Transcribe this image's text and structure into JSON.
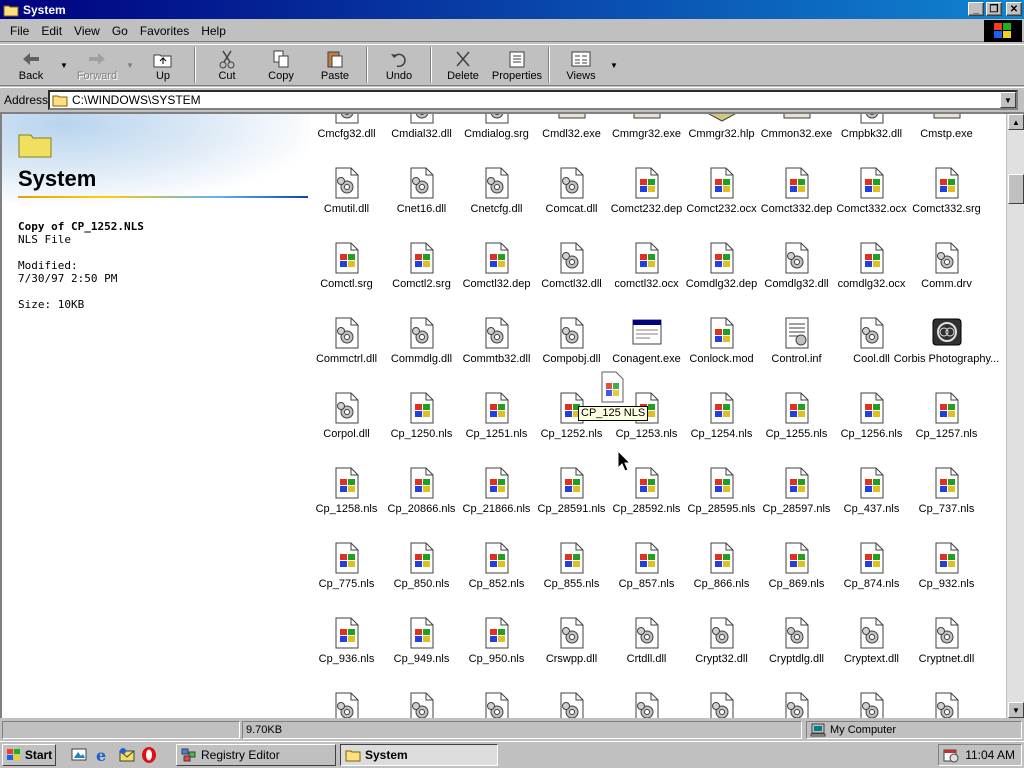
{
  "window": {
    "title": "System"
  },
  "menu": [
    "File",
    "Edit",
    "View",
    "Go",
    "Favorites",
    "Help"
  ],
  "toolbar": {
    "back": "Back",
    "forward": "Forward",
    "up": "Up",
    "cut": "Cut",
    "copy": "Copy",
    "paste": "Paste",
    "undo": "Undo",
    "delete": "Delete",
    "properties": "Properties",
    "views": "Views"
  },
  "address": {
    "label": "Address",
    "value": "C:\\WINDOWS\\SYSTEM"
  },
  "left_pane": {
    "title": "System",
    "selected_name": "Copy of CP_1252.NLS",
    "selected_type": "NLS File",
    "modified_label": "Modified:",
    "modified_value": "7/30/97 2:50 PM",
    "size": "Size: 10KB"
  },
  "files": [
    {
      "name": "Cmcfg32.dll",
      "icon": "dll"
    },
    {
      "name": "Cmdial32.dll",
      "icon": "dll"
    },
    {
      "name": "Cmdialog.srg",
      "icon": "dll"
    },
    {
      "name": "Cmdl32.exe",
      "icon": "exe"
    },
    {
      "name": "Cmmgr32.exe",
      "icon": "exe"
    },
    {
      "name": "Cmmgr32.hlp",
      "icon": "hlp"
    },
    {
      "name": "Cmmon32.exe",
      "icon": "exe"
    },
    {
      "name": "Cmpbk32.dll",
      "icon": "dll"
    },
    {
      "name": "Cmstp.exe",
      "icon": "exe"
    },
    {
      "name": "Cmutil.dll",
      "icon": "dll"
    },
    {
      "name": "Cnet16.dll",
      "icon": "dll"
    },
    {
      "name": "Cnetcfg.dll",
      "icon": "dll"
    },
    {
      "name": "Comcat.dll",
      "icon": "dll"
    },
    {
      "name": "Comct232.dep",
      "icon": "win"
    },
    {
      "name": "Comct232.ocx",
      "icon": "win"
    },
    {
      "name": "Comct332.dep",
      "icon": "win"
    },
    {
      "name": "Comct332.ocx",
      "icon": "win"
    },
    {
      "name": "Comct332.srg",
      "icon": "win"
    },
    {
      "name": "Comctl.srg",
      "icon": "win"
    },
    {
      "name": "Comctl2.srg",
      "icon": "win"
    },
    {
      "name": "Comctl32.dep",
      "icon": "win"
    },
    {
      "name": "Comctl32.dll",
      "icon": "dll"
    },
    {
      "name": "comctl32.ocx",
      "icon": "win"
    },
    {
      "name": "Comdlg32.dep",
      "icon": "win"
    },
    {
      "name": "Comdlg32.dll",
      "icon": "dll"
    },
    {
      "name": "comdlg32.ocx",
      "icon": "win"
    },
    {
      "name": "Comm.drv",
      "icon": "dll"
    },
    {
      "name": "Commctrl.dll",
      "icon": "dll"
    },
    {
      "name": "Commdlg.dll",
      "icon": "dll"
    },
    {
      "name": "Commtb32.dll",
      "icon": "dll"
    },
    {
      "name": "Compobj.dll",
      "icon": "dll"
    },
    {
      "name": "Conagent.exe",
      "icon": "app"
    },
    {
      "name": "Conlock.mod",
      "icon": "win"
    },
    {
      "name": "Control.inf",
      "icon": "inf"
    },
    {
      "name": "Cool.dll",
      "icon": "dll"
    },
    {
      "name": "Corbis Photography...",
      "icon": "corbis"
    },
    {
      "name": "Corpol.dll",
      "icon": "dll"
    },
    {
      "name": "Cp_1250.nls",
      "icon": "win"
    },
    {
      "name": "Cp_1251.nls",
      "icon": "win"
    },
    {
      "name": "Cp_1252.nls",
      "icon": "win"
    },
    {
      "name": "Cp_1253.nls",
      "icon": "win"
    },
    {
      "name": "Cp_1254.nls",
      "icon": "win"
    },
    {
      "name": "Cp_1255.nls",
      "icon": "win"
    },
    {
      "name": "Cp_1256.nls",
      "icon": "win"
    },
    {
      "name": "Cp_1257.nls",
      "icon": "win"
    },
    {
      "name": "Cp_1258.nls",
      "icon": "win"
    },
    {
      "name": "Cp_20866.nls",
      "icon": "win"
    },
    {
      "name": "Cp_21866.nls",
      "icon": "win"
    },
    {
      "name": "Cp_28591.nls",
      "icon": "win"
    },
    {
      "name": "Cp_28592.nls",
      "icon": "win"
    },
    {
      "name": "Cp_28595.nls",
      "icon": "win"
    },
    {
      "name": "Cp_28597.nls",
      "icon": "win"
    },
    {
      "name": "Cp_437.nls",
      "icon": "win"
    },
    {
      "name": "Cp_737.nls",
      "icon": "win"
    },
    {
      "name": "Cp_775.nls",
      "icon": "win"
    },
    {
      "name": "Cp_850.nls",
      "icon": "win"
    },
    {
      "name": "Cp_852.nls",
      "icon": "win"
    },
    {
      "name": "Cp_855.nls",
      "icon": "win"
    },
    {
      "name": "Cp_857.nls",
      "icon": "win"
    },
    {
      "name": "Cp_866.nls",
      "icon": "win"
    },
    {
      "name": "Cp_869.nls",
      "icon": "win"
    },
    {
      "name": "Cp_874.nls",
      "icon": "win"
    },
    {
      "name": "Cp_932.nls",
      "icon": "win"
    },
    {
      "name": "Cp_936.nls",
      "icon": "win"
    },
    {
      "name": "Cp_949.nls",
      "icon": "win"
    },
    {
      "name": "Cp_950.nls",
      "icon": "win"
    },
    {
      "name": "Crswpp.dll",
      "icon": "dll"
    },
    {
      "name": "Crtdll.dll",
      "icon": "dll"
    },
    {
      "name": "Crypt32.dll",
      "icon": "dll"
    },
    {
      "name": "Cryptdlg.dll",
      "icon": "dll"
    },
    {
      "name": "Cryptext.dll",
      "icon": "dll"
    },
    {
      "name": "Cryptnet.dll",
      "icon": "dll"
    },
    {
      "name": "",
      "icon": "dll"
    },
    {
      "name": "",
      "icon": "dll"
    },
    {
      "name": "",
      "icon": "dll"
    },
    {
      "name": "",
      "icon": "dll"
    },
    {
      "name": "",
      "icon": "dll"
    },
    {
      "name": "",
      "icon": "dll"
    },
    {
      "name": "",
      "icon": "dll"
    },
    {
      "name": "",
      "icon": "dll"
    },
    {
      "name": "",
      "icon": "dll"
    }
  ],
  "drag": {
    "tooltip": "CP_125 NLS"
  },
  "status": {
    "size": "9.70KB",
    "zone": "My Computer"
  },
  "taskbar": {
    "start": "Start",
    "tasks": [
      "Registry Editor",
      "System"
    ],
    "clock": "11:04 AM"
  }
}
